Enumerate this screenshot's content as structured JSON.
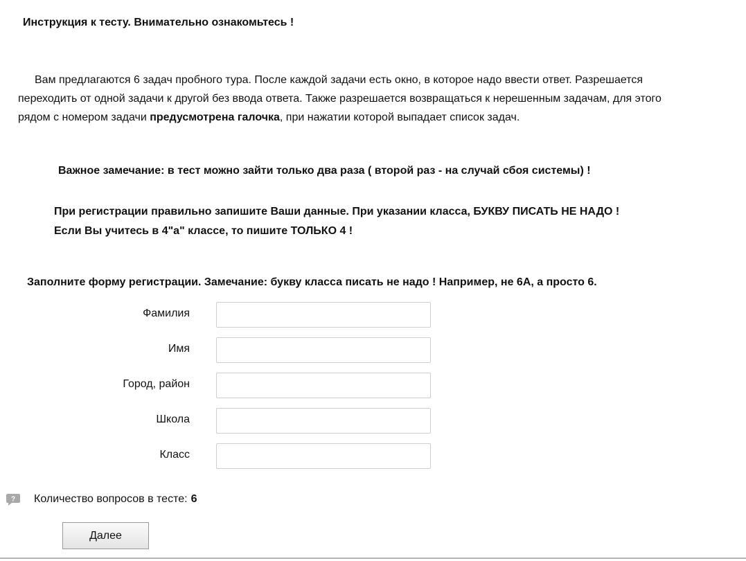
{
  "instruction": {
    "title": "Инструкция к тесту. Внимательно ознакомьтесь !",
    "intro_lines": [
      "Вам предлагаются 6 задач пробного тура.  После каждой задачи есть окно, в которое надо ввести ответ.  Разрешается",
      "переходить от одной задачи к другой без ввода ответа. Также разрешается возвращаться к нерешенным задачам, для этого"
    ],
    "intro_line3_start": "рядом с номером задачи ",
    "intro_line3_bold": "предусмотрена галочка",
    "intro_line3_end": ", при нажатии которой выпадает список задач.",
    "important_note": "Важное замечание: в тест можно зайти только два раза ( второй раз - на случай сбоя системы) !",
    "registration_note_line1": "При регистрации правильно запишите Ваши данные. При указании класса, БУКВУ ПИСАТЬ НЕ НАДО !",
    "registration_note_line2": "Если Вы учитесь в 4\"а\" классе, то пишите  ТОЛЬКО  4 !"
  },
  "form": {
    "heading": "Заполните форму регистрации. Замечание: букву класса писать не надо ! Например, не 6А, а просто 6.",
    "fields": [
      {
        "label": "Фамилия",
        "value": ""
      },
      {
        "label": "Имя",
        "value": ""
      },
      {
        "label": "Город, район",
        "value": ""
      },
      {
        "label": "Школа",
        "value": ""
      },
      {
        "label": "Класс",
        "value": ""
      }
    ]
  },
  "info": {
    "question_count_label": "Количество вопросов в тесте:",
    "question_count_value": "6",
    "help_icon": "help-bubble-icon",
    "help_icon_glyph": "?"
  },
  "actions": {
    "next_label": "Далее"
  },
  "colors": {
    "icon": "#a9a9a9",
    "input_border": "#cfcfcf",
    "button_border": "#9a9a9a"
  }
}
